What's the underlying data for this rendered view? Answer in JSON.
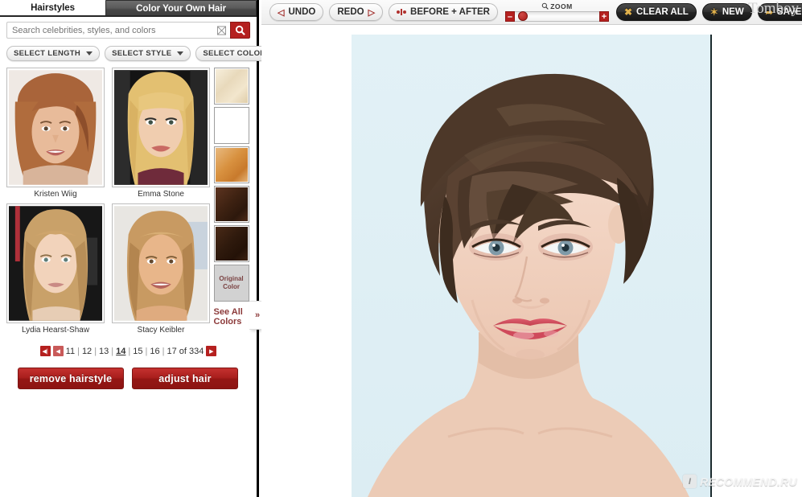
{
  "sidebar": {
    "tabs": [
      {
        "label": "Hairstyles",
        "active": true
      },
      {
        "label": "Color Your Own Hair",
        "active": false
      }
    ],
    "search": {
      "placeholder": "Search celebrities, styles, and colors",
      "value": "",
      "clear_icon": "close-x-icon",
      "submit_icon": "search-icon"
    },
    "filters": [
      {
        "label": "SELECT LENGTH",
        "icon": "chevron-down-icon"
      },
      {
        "label": "SELECT STYLE",
        "icon": "chevron-down-icon"
      },
      {
        "label": "SELECT COLOR",
        "icon": "chevron-down-icon"
      }
    ],
    "thumbnails": [
      {
        "label": "Kristen Wiig"
      },
      {
        "label": "Emma Stone"
      },
      {
        "label": "Lydia Hearst-Shaw"
      },
      {
        "label": "Stacy Keibler"
      }
    ],
    "color_swatches": [
      {
        "name": "platinum-blonde",
        "color": "#ece0c8"
      },
      {
        "name": "golden-blonde",
        "color": "#d9b87a"
      },
      {
        "name": "strawberry-copper",
        "color": "#d79353"
      },
      {
        "name": "dark-brown",
        "color": "#4a2a1a"
      },
      {
        "name": "darkest-brown",
        "color": "#3a2113"
      }
    ],
    "original_color": {
      "line1": "Original",
      "line2": "Color",
      "bg": "#d2d2d2"
    },
    "see_all_colors": {
      "line1": "See All",
      "line2": "Colors",
      "arrow": "»"
    },
    "pagination": {
      "first_icon": "⏮",
      "prev_icon": "◀",
      "next_icon": "▶",
      "pages": [
        "11",
        "12",
        "13",
        "14",
        "15",
        "16",
        "17"
      ],
      "current": "14",
      "separator": "|",
      "total_text": "of 334"
    },
    "actions": [
      {
        "label": "remove hairstyle"
      },
      {
        "label": "adjust hair"
      }
    ]
  },
  "toolbar": {
    "undo": {
      "label": "UNDO",
      "icon": "chevron-left-icon"
    },
    "redo": {
      "label": "REDO",
      "icon": "chevron-right-icon"
    },
    "before_after": {
      "label": "BEFORE + AFTER",
      "icon": "compare-icon"
    },
    "zoom": {
      "label": "ZOOM",
      "icon": "magnifier-icon",
      "minus": "–",
      "plus": "+",
      "value": 6
    },
    "clear_all": {
      "label": "CLEAR ALL",
      "icon": "x-icon"
    },
    "new": {
      "label": "NEW",
      "icon": "star-icon"
    },
    "save_or_share": {
      "label": "SAVE OR SHARE",
      "icon": "share-icon"
    }
  },
  "canvas": {
    "photo_alt": "woman-with-short-dark-pixie-hairstyle",
    "background_color": "#dff0f5",
    "overlay_text": "Tomboy"
  },
  "watermark": {
    "badge": "I",
    "text": "RECOMMEND.RU"
  },
  "colors": {
    "accent_red": "#b5201f",
    "dark_button": "#242424",
    "gold_icon": "#e0b14c"
  }
}
